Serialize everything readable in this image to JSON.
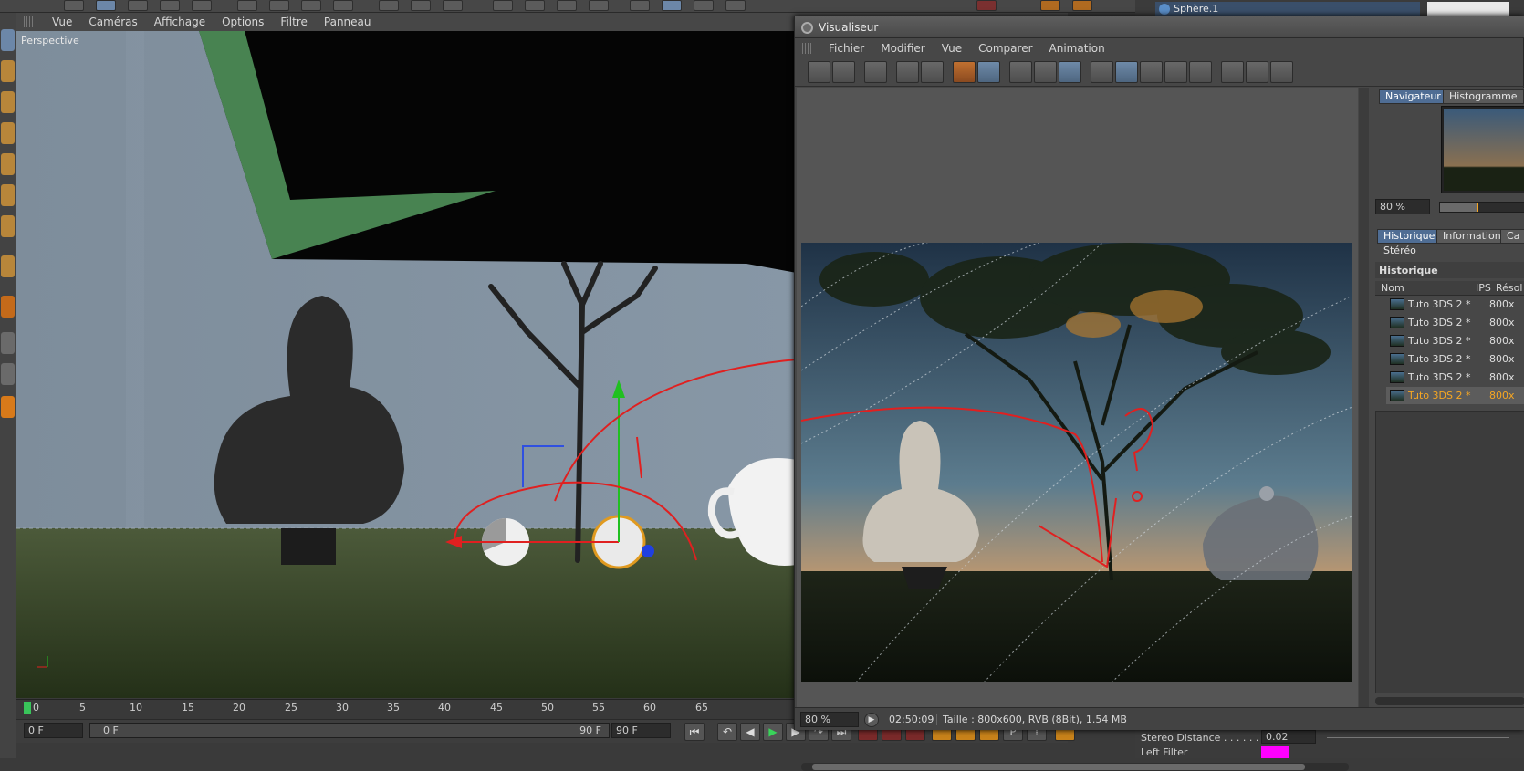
{
  "viewport": {
    "menu": [
      "Vue",
      "Caméras",
      "Affichage",
      "Options",
      "Filtre",
      "Panneau"
    ],
    "camera_label": "Perspective"
  },
  "timeline": {
    "ticks": [
      "0",
      "5",
      "10",
      "15",
      "20",
      "25",
      "30",
      "35",
      "40",
      "45",
      "50",
      "55",
      "60",
      "65"
    ]
  },
  "bottom_bar": {
    "start_frame": "0 F",
    "range_start": "0 F",
    "range_end": "90 F",
    "end_frame": "90 F"
  },
  "object_manager": {
    "item_label": "Sphère.1"
  },
  "attributes": {
    "stereo_distance_label": "Stereo Distance . . . . . .",
    "stereo_distance_value": "0.02",
    "left_filter_label": "Left Filter",
    "left_filter_color": "#ff00ff"
  },
  "picture_viewer": {
    "title": "Visualiseur",
    "menu": [
      "Fichier",
      "Modifier",
      "Vue",
      "Comparer",
      "Animation"
    ],
    "tabs_top": [
      "Navigateur",
      "Histogramme"
    ],
    "navigator_zoom": "80 %",
    "tabs_middle": [
      "Historique",
      "Information",
      "Ca"
    ],
    "tab_stereo": "Stéréo",
    "history_section": "Historique",
    "history_columns": [
      "Nom",
      "IPS",
      "Résol"
    ],
    "history_rows": [
      {
        "name": "Tuto 3DS 2 *",
        "res": "800x"
      },
      {
        "name": "Tuto 3DS 2 *",
        "res": "800x"
      },
      {
        "name": "Tuto 3DS 2 *",
        "res": "800x"
      },
      {
        "name": "Tuto 3DS 2 *",
        "res": "800x"
      },
      {
        "name": "Tuto 3DS 2 *",
        "res": "800x"
      },
      {
        "name": "Tuto 3DS 2 *",
        "res": "800x"
      }
    ],
    "selected_history_row": 5,
    "status_zoom": "80 %",
    "status_time": "02:50:09",
    "status_info": "Taille : 800x600, RVB (8Bit), 1.54 MB"
  },
  "colors": {
    "accent_blue": "#4f6d94",
    "selected_orange": "#f5a623",
    "annotation_red": "#e02020"
  }
}
